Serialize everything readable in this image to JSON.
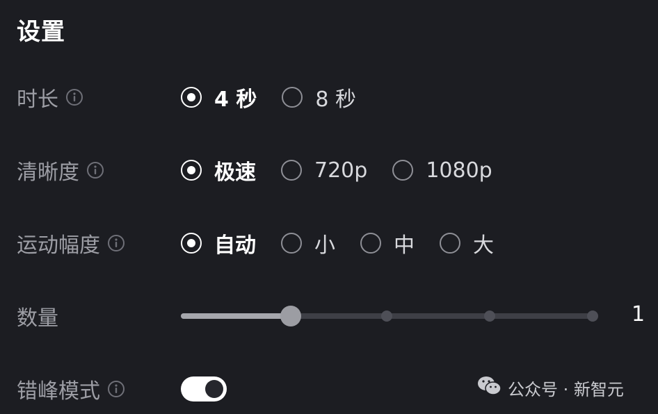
{
  "title": "设置",
  "rows": {
    "duration": {
      "label": "时长",
      "options": [
        {
          "label": "4 秒",
          "checked": true
        },
        {
          "label": "8 秒",
          "checked": false
        }
      ]
    },
    "resolution": {
      "label": "清晰度",
      "options": [
        {
          "label": "极速",
          "checked": true
        },
        {
          "label": "720p",
          "checked": false
        },
        {
          "label": "1080p",
          "checked": false
        }
      ]
    },
    "motion": {
      "label": "运动幅度",
      "options": [
        {
          "label": "自动",
          "checked": true
        },
        {
          "label": "小",
          "checked": false
        },
        {
          "label": "中",
          "checked": false
        },
        {
          "label": "大",
          "checked": false
        }
      ]
    },
    "quantity": {
      "label": "数量",
      "value": "1",
      "steps": 5,
      "current_step": 1
    },
    "staggered": {
      "label": "错峰模式",
      "enabled": true
    }
  },
  "watermark": {
    "text": "公众号 · 新智元",
    "icon": "wechat-icon"
  },
  "colors": {
    "background": "#1c1d22",
    "label": "#9d9ea5",
    "selected": "#ffffff",
    "track": "#3e3f46",
    "thumb": "#9c9da3"
  }
}
